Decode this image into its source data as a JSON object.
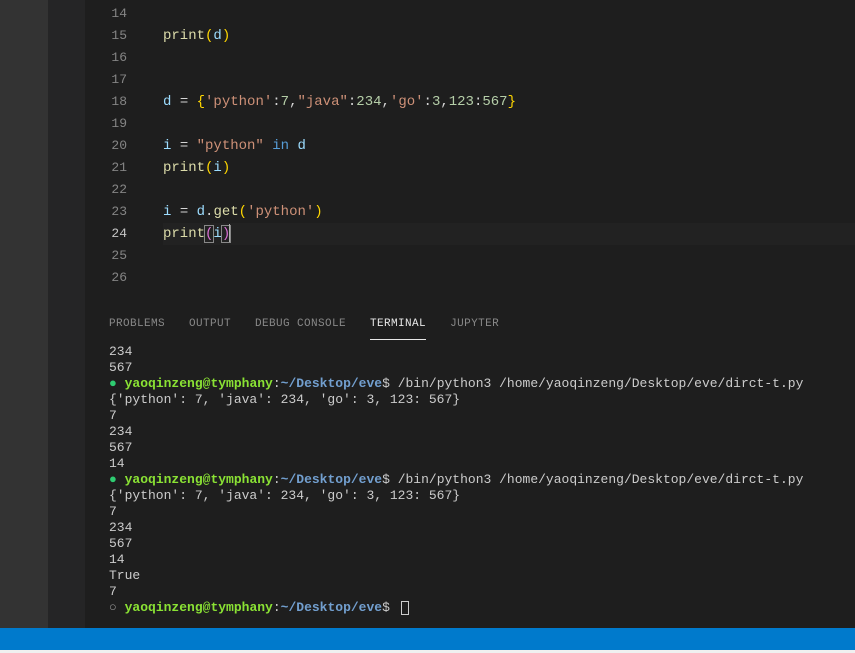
{
  "editor": {
    "lines": [
      {
        "num": 14,
        "tokens": []
      },
      {
        "num": 15,
        "tokens": [
          {
            "t": "print",
            "c": "tok-fn"
          },
          {
            "t": "(",
            "c": "tok-yell"
          },
          {
            "t": "d",
            "c": "tok-var"
          },
          {
            "t": ")",
            "c": "tok-yell"
          }
        ]
      },
      {
        "num": 16,
        "tokens": []
      },
      {
        "num": 17,
        "tokens": []
      },
      {
        "num": 18,
        "tokens": [
          {
            "t": "d",
            "c": "tok-var"
          },
          {
            "t": " ",
            "c": "tok-punct"
          },
          {
            "t": "=",
            "c": "tok-punct"
          },
          {
            "t": " ",
            "c": "tok-punct"
          },
          {
            "t": "{",
            "c": "tok-yell"
          },
          {
            "t": "'python'",
            "c": "tok-str"
          },
          {
            "t": ":",
            "c": "tok-punct"
          },
          {
            "t": "7",
            "c": "tok-num"
          },
          {
            "t": ",",
            "c": "tok-punct"
          },
          {
            "t": "\"java\"",
            "c": "tok-str"
          },
          {
            "t": ":",
            "c": "tok-punct"
          },
          {
            "t": "234",
            "c": "tok-num"
          },
          {
            "t": ",",
            "c": "tok-punct"
          },
          {
            "t": "'go'",
            "c": "tok-str"
          },
          {
            "t": ":",
            "c": "tok-punct"
          },
          {
            "t": "3",
            "c": "tok-num"
          },
          {
            "t": ",",
            "c": "tok-punct"
          },
          {
            "t": "123",
            "c": "tok-num"
          },
          {
            "t": ":",
            "c": "tok-punct"
          },
          {
            "t": "567",
            "c": "tok-num"
          },
          {
            "t": "}",
            "c": "tok-yell"
          }
        ]
      },
      {
        "num": 19,
        "tokens": []
      },
      {
        "num": 20,
        "tokens": [
          {
            "t": "i",
            "c": "tok-var"
          },
          {
            "t": " ",
            "c": "tok-punct"
          },
          {
            "t": "=",
            "c": "tok-punct"
          },
          {
            "t": " ",
            "c": "tok-punct"
          },
          {
            "t": "\"python\"",
            "c": "tok-str"
          },
          {
            "t": " ",
            "c": "tok-punct"
          },
          {
            "t": "in",
            "c": "tok-kw"
          },
          {
            "t": " ",
            "c": "tok-punct"
          },
          {
            "t": "d",
            "c": "tok-var"
          }
        ]
      },
      {
        "num": 21,
        "tokens": [
          {
            "t": "print",
            "c": "tok-fn"
          },
          {
            "t": "(",
            "c": "tok-yell"
          },
          {
            "t": "i",
            "c": "tok-var"
          },
          {
            "t": ")",
            "c": "tok-yell"
          }
        ]
      },
      {
        "num": 22,
        "tokens": []
      },
      {
        "num": 23,
        "tokens": [
          {
            "t": "i",
            "c": "tok-var"
          },
          {
            "t": " ",
            "c": "tok-punct"
          },
          {
            "t": "=",
            "c": "tok-punct"
          },
          {
            "t": " ",
            "c": "tok-punct"
          },
          {
            "t": "d",
            "c": "tok-var"
          },
          {
            "t": ".",
            "c": "tok-punct"
          },
          {
            "t": "get",
            "c": "tok-fn"
          },
          {
            "t": "(",
            "c": "tok-yell"
          },
          {
            "t": "'python'",
            "c": "tok-str"
          },
          {
            "t": ")",
            "c": "tok-yell"
          }
        ]
      },
      {
        "num": 24,
        "active": true,
        "tokens": [
          {
            "t": "print",
            "c": "tok-fn"
          },
          {
            "t": "(",
            "c": "tok-purp",
            "hl": true
          },
          {
            "t": "i",
            "c": "tok-var"
          },
          {
            "t": ")",
            "c": "tok-purp",
            "hl": true
          },
          {
            "cursor": true
          }
        ]
      },
      {
        "num": 25,
        "tokens": []
      },
      {
        "num": 26,
        "tokens": []
      }
    ]
  },
  "panel": {
    "tabs": [
      "PROBLEMS",
      "OUTPUT",
      "DEBUG CONSOLE",
      "TERMINAL",
      "JUPYTER"
    ],
    "active_tab_index": 3
  },
  "terminal": {
    "user": "yaoqinzeng",
    "host": "tymphany",
    "cwd": "~/Desktop/eve",
    "cmd": "/bin/python3 /home/yaoqinzeng/Desktop/eve/dirct-t.py",
    "dict_repr": "{'python': 7, 'java': 234, 'go': 3, 123: 567}",
    "blocks": [
      {
        "pre": [
          "234",
          "567"
        ],
        "dot": "green",
        "prompt": true,
        "cmd_after": true,
        "out": [
          "{'python': 7, 'java': 234, 'go': 3, 123: 567}",
          "7",
          "234",
          "567",
          "14"
        ]
      },
      {
        "dot": "green",
        "prompt": true,
        "cmd_after": true,
        "out": [
          "{'python': 7, 'java': 234, 'go': 3, 123: 567}",
          "7",
          "234",
          "567",
          "14",
          "True",
          "7"
        ]
      },
      {
        "dot": "grey",
        "prompt": true,
        "cursor": true
      }
    ]
  }
}
